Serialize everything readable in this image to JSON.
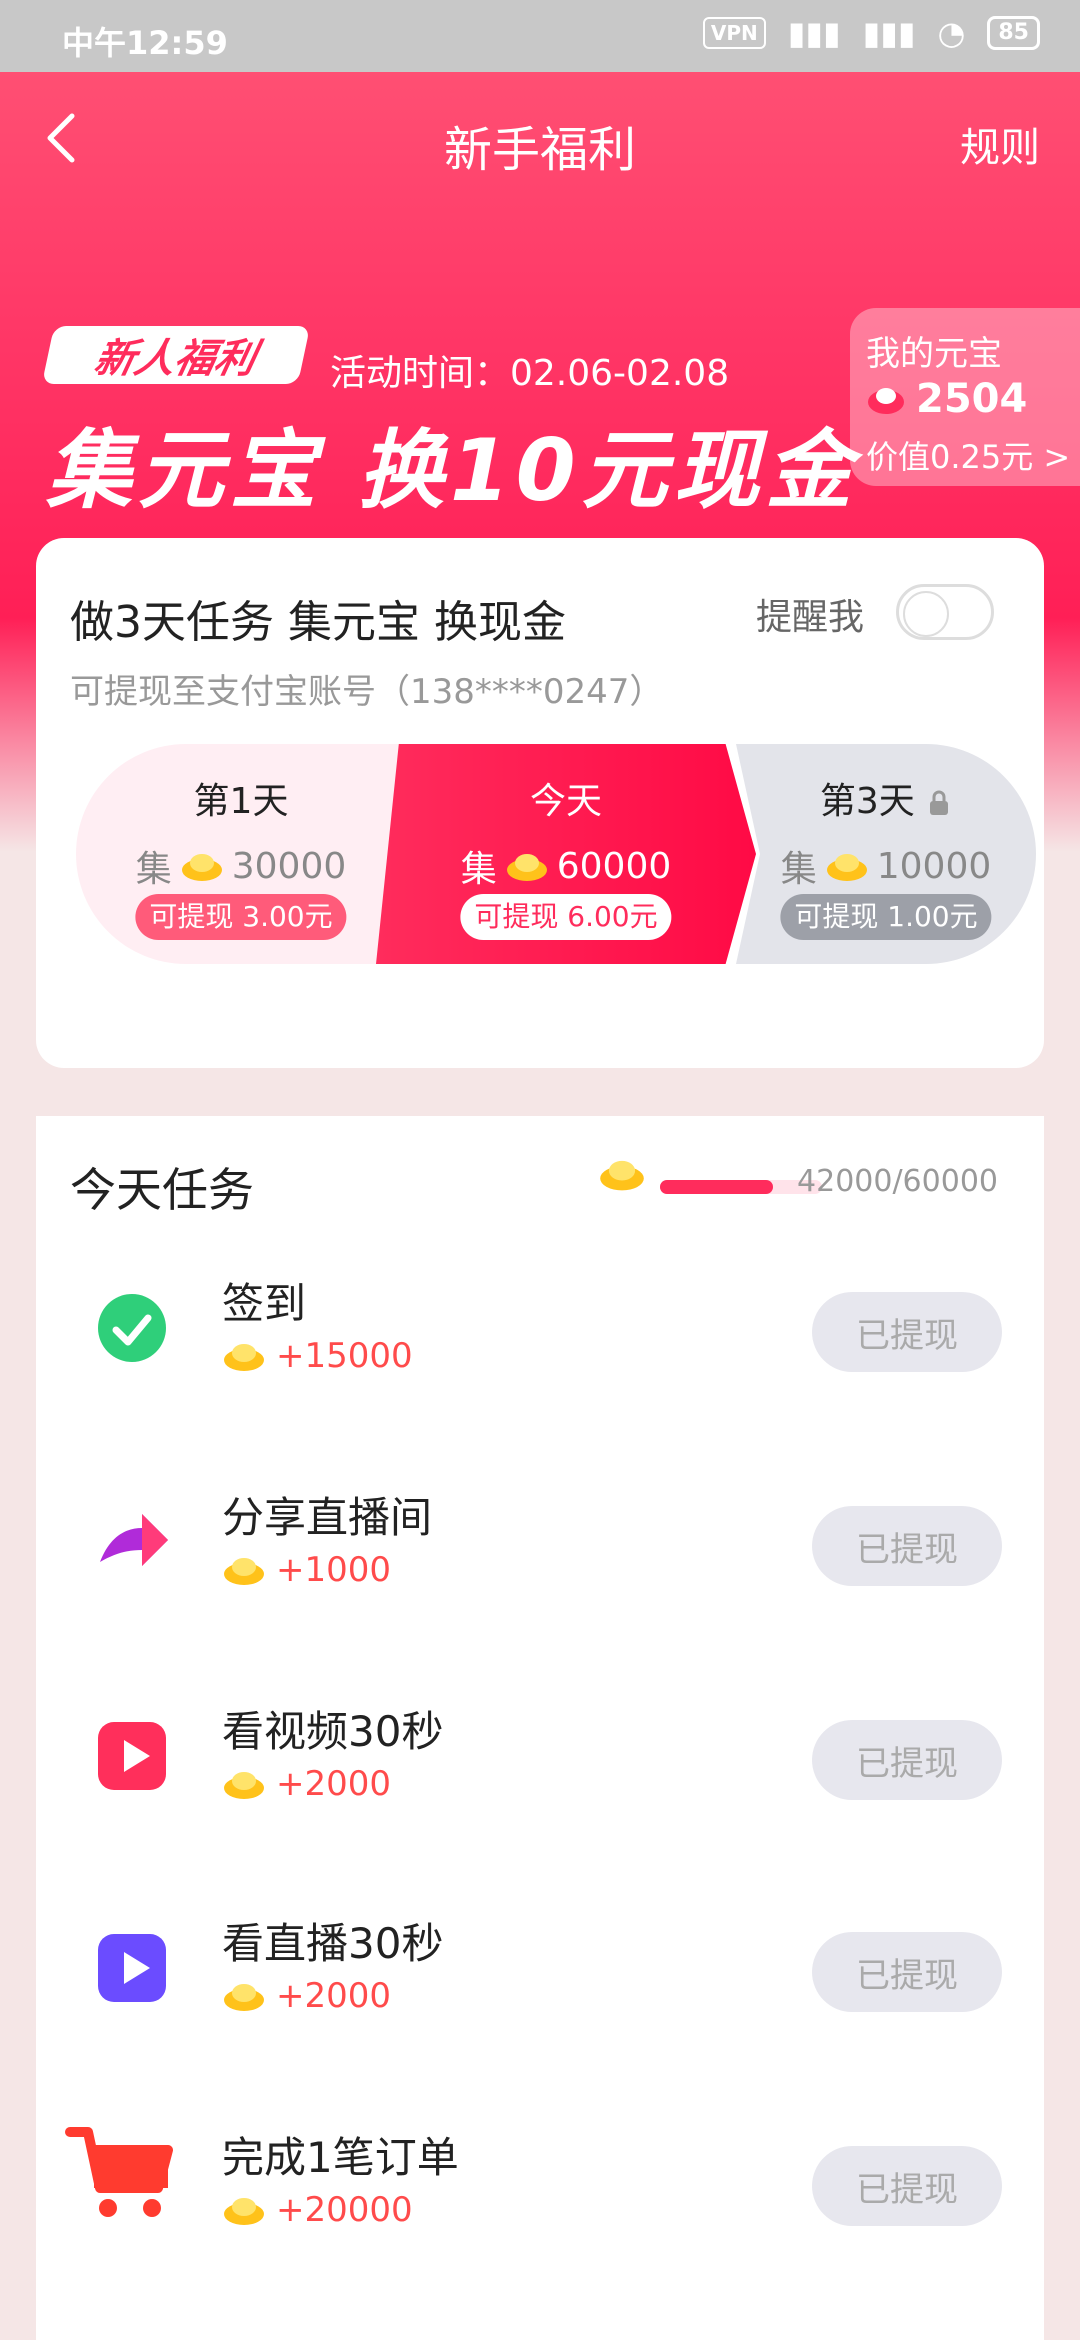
{
  "status_bar": {
    "time": "中午12:59",
    "vpn": "VPN",
    "battery": "85"
  },
  "header": {
    "title": "新手福利",
    "rules": "规则"
  },
  "hero": {
    "badge": "新人福利",
    "activity_time": "活动时间：02.06-02.08",
    "headline": "集元宝 换10元现金"
  },
  "coin_card": {
    "label": "我的元宝",
    "value": "2504",
    "sub": "价值0.25元 >"
  },
  "task_card": {
    "title": "做3天任务 集元宝 换现金",
    "remind": "提醒我",
    "subtitle": "可提现至支付宝账号（138****0247）",
    "days": [
      {
        "title": "第1天",
        "prefix": "集",
        "amount": "30000",
        "badge": "可提现 3.00元"
      },
      {
        "title": "今天",
        "prefix": "集",
        "amount": "60000",
        "badge": "可提现 6.00元"
      },
      {
        "title": "第3天",
        "prefix": "集",
        "amount": "10000",
        "badge": "可提现 1.00元"
      }
    ]
  },
  "today": {
    "title": "今天任务",
    "progress_text": "42000/60000",
    "progress_fraction": 0.7,
    "tasks": [
      {
        "name": "签到",
        "reward": "+15000",
        "button": "已提现",
        "icon": "check-icon"
      },
      {
        "name": "分享直播间",
        "reward": "+1000",
        "button": "已提现",
        "icon": "share-arrow-icon"
      },
      {
        "name": "看视频30秒",
        "reward": "+2000",
        "button": "已提现",
        "icon": "play-video-icon"
      },
      {
        "name": "看直播30秒",
        "reward": "+2000",
        "button": "已提现",
        "icon": "play-live-icon"
      },
      {
        "name": "完成1笔订单",
        "reward": "+20000",
        "button": "已提现",
        "icon": "cart-icon"
      }
    ]
  },
  "colors": {
    "accent": "#ff2c5c",
    "reward": "#ff4b4b",
    "button_bg": "#e7e7ee"
  }
}
